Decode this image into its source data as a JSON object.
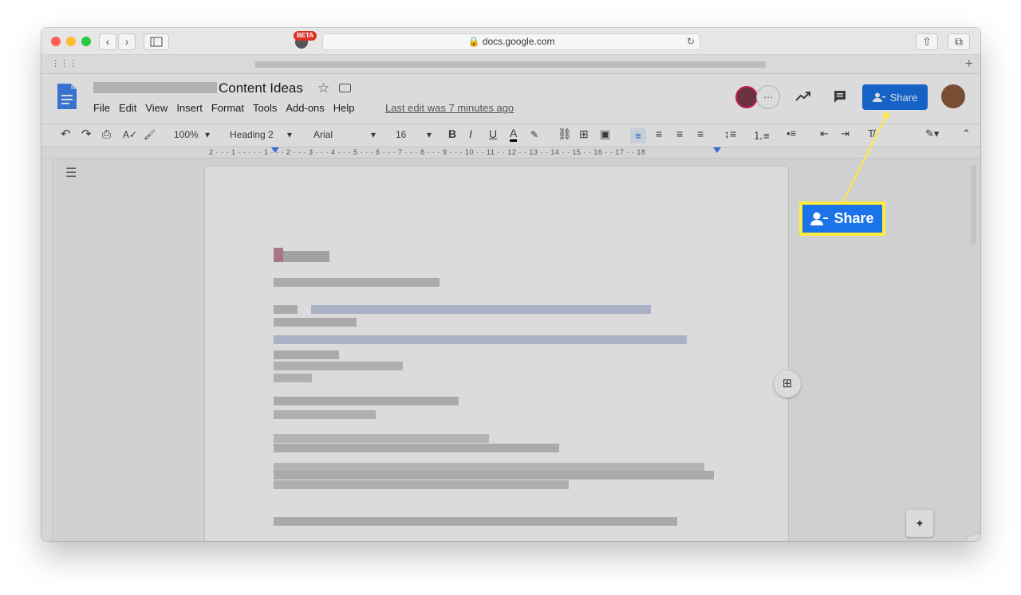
{
  "browser": {
    "url": "docs.google.com",
    "beta_badge": "BETA"
  },
  "document": {
    "title": "Content Ideas",
    "menu": [
      "File",
      "Edit",
      "View",
      "Insert",
      "Format",
      "Tools",
      "Add-ons",
      "Help"
    ],
    "last_edit": "Last edit was 7 minutes ago",
    "share_label": "Share"
  },
  "toolbar": {
    "zoom": "100%",
    "style": "Heading 2",
    "font": "Arial",
    "size": "16",
    "bold": "B",
    "italic": "I",
    "underline": "U",
    "text_color": "A"
  },
  "ruler": {
    "ticks": "2 · · · 1 · · · · · 1 · · · 2 · · · 3 · · · 4 · · · 5 · · · 6 · · · 7 · · · 8 · · · 9 · · · 10 · · 11 · · 12 · · 13 · · 14 · · 15 · · 16 · · 17 · · 18"
  },
  "callout": {
    "label": "Share",
    "color": "#ffeb3b"
  },
  "colors": {
    "accent": "#1a73e8",
    "highlight": "#ffeb3b"
  }
}
